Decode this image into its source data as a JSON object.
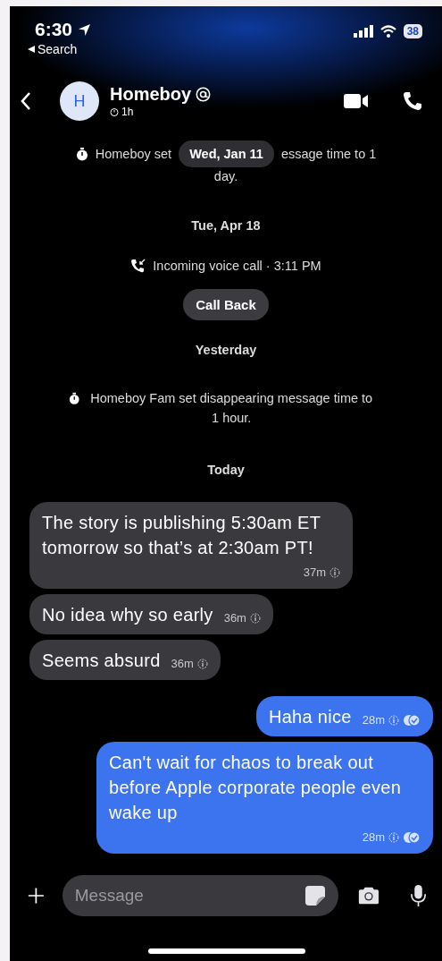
{
  "status_bar": {
    "time": "6:30",
    "back_label": "Search",
    "battery": "38"
  },
  "header": {
    "avatar_letter": "H",
    "name": "Homeboy",
    "timer": "1h"
  },
  "thread": [
    {
      "kind": "covered_notice",
      "text": "Homeboy set",
      "overlay": "Wed, Jan 11",
      "text_after": "essage time to 1",
      "line2": "day."
    },
    {
      "kind": "date",
      "text": "Tue, Apr 18"
    },
    {
      "kind": "call",
      "text": "Incoming voice call · 3:11 PM"
    },
    {
      "kind": "button",
      "text": "Call Back"
    },
    {
      "kind": "date",
      "text": "Yesterday"
    },
    {
      "kind": "notice",
      "text": "Homeboy Fam set disappearing message time to 1 hour."
    },
    {
      "kind": "date",
      "text": "Today"
    },
    {
      "kind": "message",
      "outgoing": false,
      "text": "The story is publishing 5:30am ET tomorrow so that’s at 2:30am PT!",
      "time": "37m"
    },
    {
      "kind": "message",
      "outgoing": false,
      "text": "No idea why so early",
      "time": "36m"
    },
    {
      "kind": "message",
      "outgoing": false,
      "text": "Seems absurd",
      "time": "36m"
    },
    {
      "kind": "message",
      "outgoing": true,
      "text": "Haha nice",
      "time": "28m"
    },
    {
      "kind": "message",
      "outgoing": true,
      "text": "Can't wait for chaos to break out before Apple corporate people even wake up",
      "time": "28m"
    }
  ],
  "composer": {
    "placeholder": "Message"
  }
}
